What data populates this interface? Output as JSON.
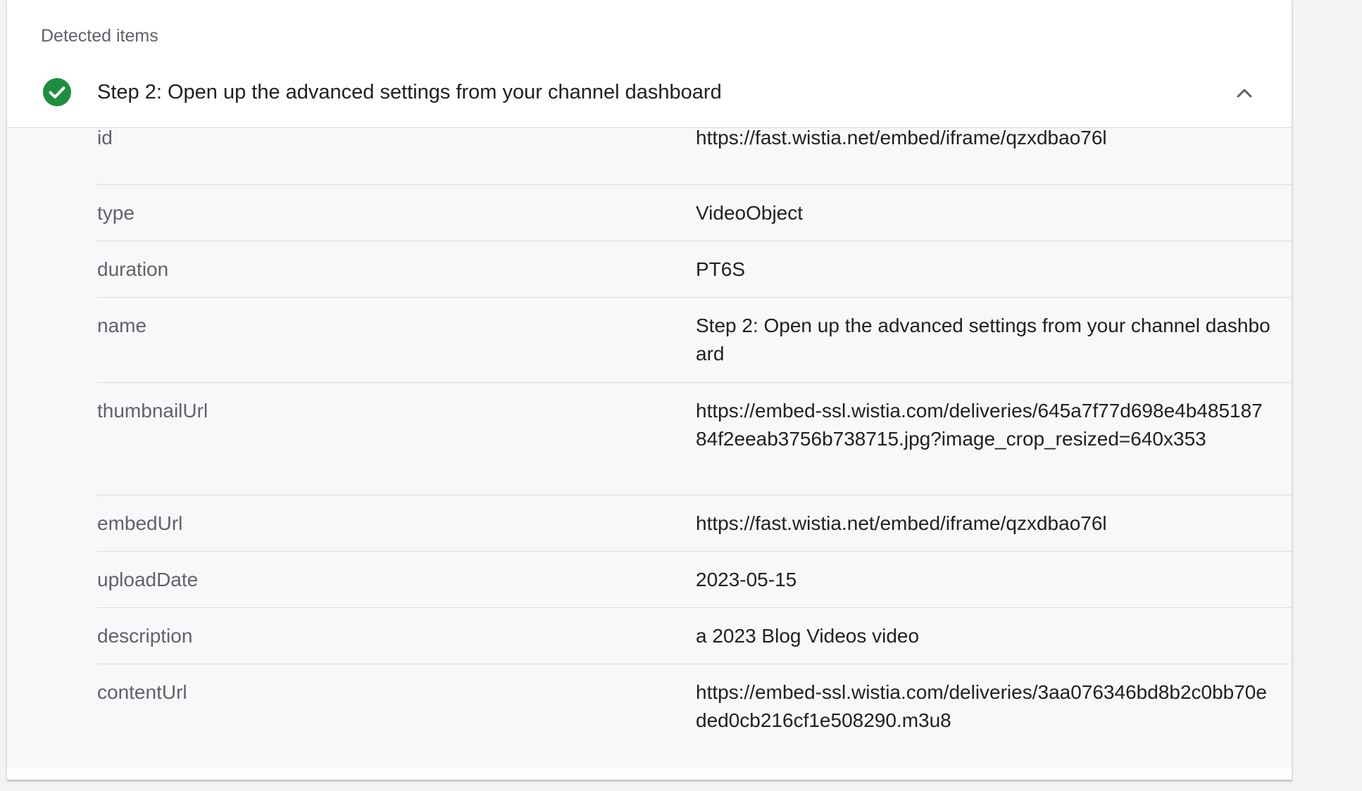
{
  "section": {
    "label": "Detected items"
  },
  "item": {
    "title": "Step 2: Open up the advanced settings from your channel dashboard",
    "status_icon": "check-circle-icon",
    "toggle_icon": "chevron-up-icon",
    "status_color": "#1e8e3e"
  },
  "properties": [
    {
      "key": "id",
      "value": "https://fast.wistia.net/embed/iframe/qzxdbao76l"
    },
    {
      "key": "type",
      "value": "VideoObject"
    },
    {
      "key": "duration",
      "value": "PT6S"
    },
    {
      "key": "name",
      "value": "Step 2: Open up the advanced settings from your channel dashboard"
    },
    {
      "key": "thumbnailUrl",
      "value": "https://embed-ssl.wistia.com/deliveries/645a7f77d698e4b48518784f2eeab3756b738715.jpg?image_crop_resized=640x353"
    },
    {
      "key": "embedUrl",
      "value": "https://fast.wistia.net/embed/iframe/qzxdbao76l"
    },
    {
      "key": "uploadDate",
      "value": "2023-05-15"
    },
    {
      "key": "description",
      "value": "a 2023 Blog Videos video"
    },
    {
      "key": "contentUrl",
      "value": "https://embed-ssl.wistia.com/deliveries/3aa076346bd8b2c0bb70eded0cb216cf1e508290.m3u8"
    }
  ]
}
